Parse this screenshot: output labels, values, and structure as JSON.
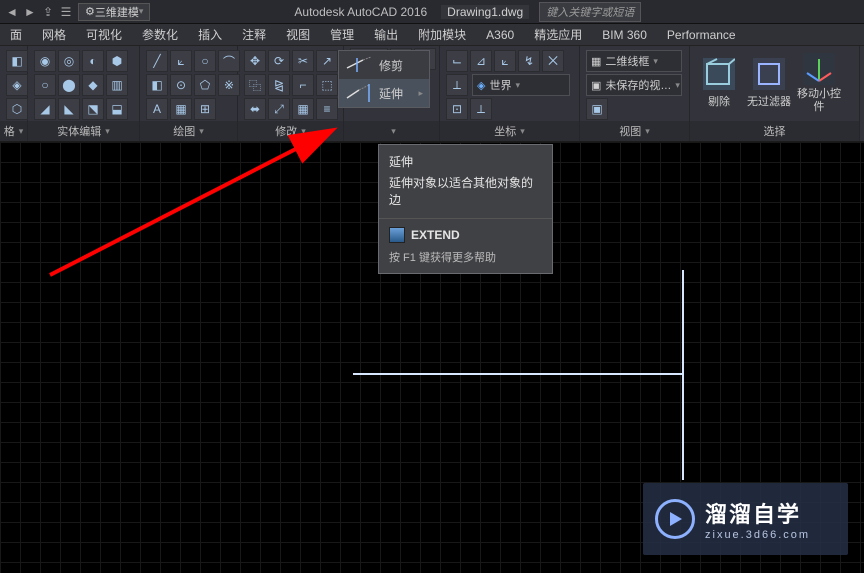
{
  "title": {
    "workspace": "三维建模",
    "app": "Autodesk AutoCAD 2016",
    "file": "Drawing1.dwg",
    "search_placeholder": "键入关键字或短语"
  },
  "menu": {
    "tabs": [
      "面",
      "网格",
      "可视化",
      "参数化",
      "插入",
      "注释",
      "视图",
      "管理",
      "输出",
      "附加模块",
      "A360",
      "精选应用",
      "BIM 360",
      "Performance"
    ]
  },
  "panels": {
    "p0": {
      "label": "格"
    },
    "p1": {
      "label": "实体编辑"
    },
    "p2": {
      "label": "绘图"
    },
    "p3": {
      "label": "修改"
    },
    "p4": {
      "label": ""
    },
    "p5": {
      "label": "坐标",
      "world": "世界"
    },
    "p6": {
      "label": "视图",
      "vs": "二维线框",
      "view": "未保存的视…"
    },
    "p7": {
      "label": "选择",
      "b1": "剔除",
      "b2": "无过滤器",
      "b3": "移动小控件"
    }
  },
  "flyout": {
    "trim": "修剪",
    "extend": "延伸"
  },
  "tooltip": {
    "title": "延伸",
    "desc": "延伸对象以适合其他对象的边",
    "cmd": "EXTEND",
    "help": "按 F1 键获得更多帮助"
  },
  "watermark": {
    "title": "溜溜自学",
    "sub": "zixue.3d66.com"
  }
}
